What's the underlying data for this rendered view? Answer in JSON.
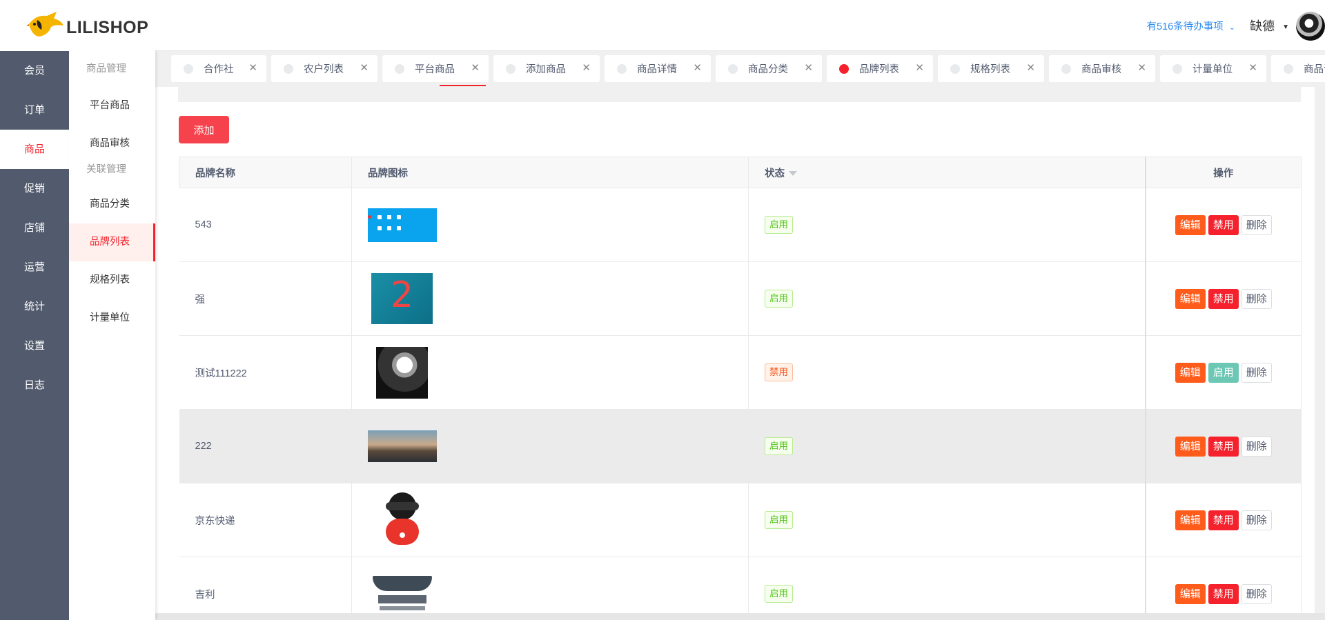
{
  "logo": {
    "text": "LILISHOP"
  },
  "main_menu": [
    "会员",
    "订单",
    "商品",
    "促销",
    "店铺",
    "运营",
    "统计",
    "设置",
    "日志"
  ],
  "main_menu_active": "商品",
  "sub_menu": {
    "group1": "商品管理",
    "group1_items": [
      "平台商品",
      "商品审核"
    ],
    "group2": "关联管理",
    "group2_items": [
      "商品分类",
      "品牌列表",
      "规格列表",
      "计量单位"
    ],
    "active": "品牌列表"
  },
  "header": {
    "todo": "有516条待办事项",
    "user": "缺德"
  },
  "tabs": [
    "合作社",
    "农户列表",
    "平台商品",
    "添加商品",
    "商品详情",
    "商品分类",
    "品牌列表",
    "规格列表",
    "商品审核",
    "计量单位",
    "商品详"
  ],
  "active_tab": "品牌列表",
  "add_button": "添加",
  "table": {
    "headers": {
      "name": "品牌名称",
      "icon": "品牌图标",
      "status": "状态",
      "ops": "操作"
    },
    "rows": [
      {
        "name": "543",
        "status": "启用",
        "ops": [
          "编辑",
          "禁用",
          "删除"
        ]
      },
      {
        "name": "强",
        "status": "启用",
        "ops": [
          "编辑",
          "禁用",
          "删除"
        ]
      },
      {
        "name": "测试111222",
        "status": "禁用",
        "ops": [
          "编辑",
          "启用",
          "删除"
        ]
      },
      {
        "name": "222",
        "status": "启用",
        "ops": [
          "编辑",
          "禁用",
          "删除"
        ]
      },
      {
        "name": "京东快递",
        "status": "启用",
        "ops": [
          "编辑",
          "禁用",
          "删除"
        ]
      },
      {
        "name": "吉利",
        "status": "启用",
        "ops": [
          "编辑",
          "禁用",
          "删除"
        ]
      }
    ]
  },
  "colors": {
    "primary_red": "#f5222d",
    "edit_orange": "#ff5c1c",
    "sidebar": "#525b6d",
    "link_blue": "#2d8cf0"
  }
}
